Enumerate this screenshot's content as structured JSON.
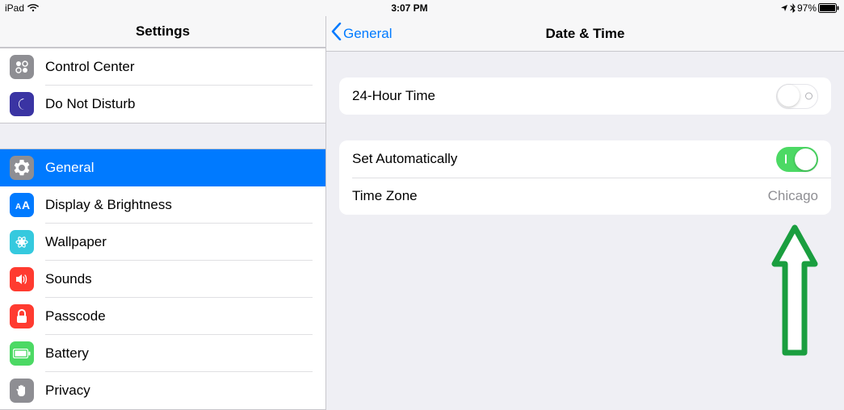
{
  "statusbar": {
    "device": "iPad",
    "time": "3:07 PM",
    "battery_pct": "97%"
  },
  "sidebar": {
    "title": "Settings",
    "group1": [
      {
        "key": "control-center",
        "label": "Control Center",
        "icon": "control-center-icon",
        "icclass": "ic-control"
      },
      {
        "key": "dnd",
        "label": "Do Not Disturb",
        "icon": "moon-icon",
        "icclass": "ic-dnd"
      }
    ],
    "group2": [
      {
        "key": "general",
        "label": "General",
        "icon": "gear-icon",
        "icclass": "ic-general",
        "selected": true
      },
      {
        "key": "display",
        "label": "Display & Brightness",
        "icon": "text-size-icon",
        "icclass": "ic-display"
      },
      {
        "key": "wallpaper",
        "label": "Wallpaper",
        "icon": "flower-icon",
        "icclass": "ic-wallpaper"
      },
      {
        "key": "sounds",
        "label": "Sounds",
        "icon": "speaker-icon",
        "icclass": "ic-sounds"
      },
      {
        "key": "passcode",
        "label": "Passcode",
        "icon": "lock-icon",
        "icclass": "ic-passcode"
      },
      {
        "key": "battery",
        "label": "Battery",
        "icon": "battery-icon",
        "icclass": "ic-battery"
      },
      {
        "key": "privacy",
        "label": "Privacy",
        "icon": "hand-icon",
        "icclass": "ic-privacy"
      }
    ]
  },
  "detail": {
    "back_label": "General",
    "title": "Date & Time",
    "rows": {
      "twenty_four_hour": {
        "label": "24-Hour Time",
        "on": false
      },
      "set_auto": {
        "label": "Set Automatically",
        "on": true
      },
      "timezone": {
        "label": "Time Zone",
        "value": "Chicago"
      }
    }
  },
  "annotation": {
    "arrow_color": "#1a9e3f"
  }
}
